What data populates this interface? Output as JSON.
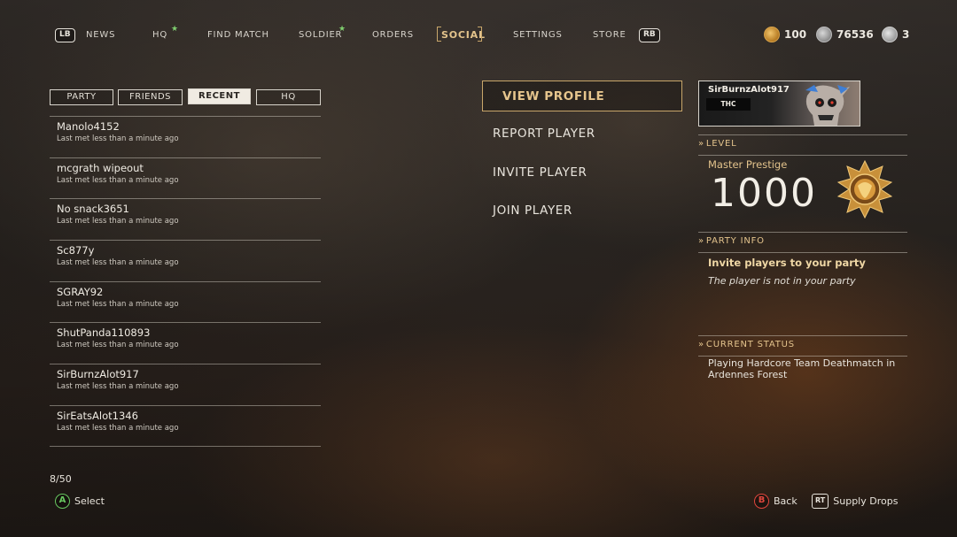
{
  "topnav": {
    "lb": "LB",
    "rb": "RB",
    "items": [
      {
        "label": "NEWS"
      },
      {
        "label": "HQ",
        "starred": true
      },
      {
        "label": "FIND MATCH"
      },
      {
        "label": "SOLDIER",
        "starred": true
      },
      {
        "label": "ORDERS"
      },
      {
        "label": "SOCIAL",
        "active": true
      },
      {
        "label": "SETTINGS"
      },
      {
        "label": "STORE"
      }
    ],
    "star_glyph": "★",
    "currencies": [
      {
        "icon": "gold-coin-icon",
        "value": "100"
      },
      {
        "icon": "armory-credit-icon",
        "value": "76536"
      },
      {
        "icon": "supply-drop-icon",
        "value": "3"
      }
    ]
  },
  "tabs": [
    {
      "label": "PARTY"
    },
    {
      "label": "FRIENDS"
    },
    {
      "label": "RECENT",
      "active": true
    },
    {
      "label": "HQ"
    }
  ],
  "players": [
    {
      "name": "Manolo4152",
      "met": "Last met less than a minute ago"
    },
    {
      "name": "mcgrath wipeout",
      "met": "Last met less than a minute ago"
    },
    {
      "name": "No snack3651",
      "met": "Last met less than a minute ago"
    },
    {
      "name": "Sc877y",
      "met": "Last met less than a minute ago"
    },
    {
      "name": "SGRAY92",
      "met": "Last met less than a minute ago"
    },
    {
      "name": "ShutPanda110893",
      "met": "Last met less than a minute ago"
    },
    {
      "name": "SirBurnzAlot917",
      "met": "Last met less than a minute ago"
    },
    {
      "name": "SirEatsAlot1346",
      "met": "Last met less than a minute ago"
    }
  ],
  "counter": "8/50",
  "actions": [
    {
      "label": "VIEW PROFILE",
      "selected": true
    },
    {
      "label": "REPORT PLAYER"
    },
    {
      "label": "INVITE PLAYER"
    },
    {
      "label": "JOIN PLAYER"
    }
  ],
  "profile": {
    "name": "SirBurnzAlot917",
    "clan_tag": "THC",
    "level_heading": "LEVEL",
    "prestige_label": "Master Prestige",
    "level_value": "1000",
    "party_heading": "PARTY INFO",
    "party_title": "Invite players to your party",
    "party_status": "The player is not in your party",
    "status_heading": "CURRENT STATUS",
    "status_text": "Playing Hardcore Team Deathmatch in Ardennes Forest"
  },
  "hints": {
    "select_button": "A",
    "select_label": "Select",
    "back_button": "B",
    "back_label": "Back",
    "rt_button": "RT",
    "supply_label": "Supply Drops"
  },
  "colors": {
    "accent_gold": "#e3c38c",
    "a_button": "#68c760",
    "b_button": "#e0463d"
  }
}
